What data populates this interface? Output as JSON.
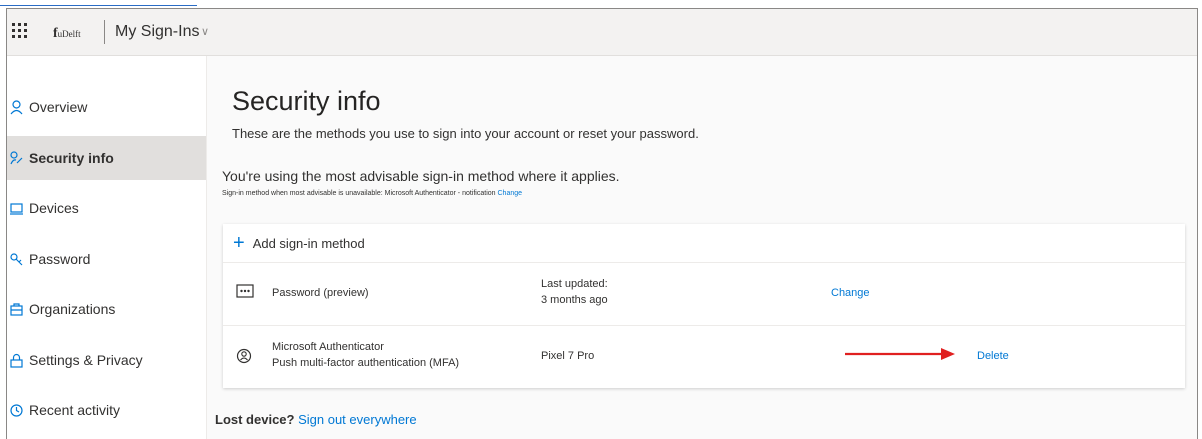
{
  "header": {
    "logo_mark": "f",
    "logo_text": "uDelft",
    "app_title": "My Sign-Ins"
  },
  "sidebar": {
    "items": [
      {
        "label": "Overview",
        "icon": "person-icon",
        "active": false
      },
      {
        "label": "Security info",
        "icon": "key-person-icon",
        "active": true
      },
      {
        "label": "Devices",
        "icon": "laptop-icon",
        "active": false
      },
      {
        "label": "Password",
        "icon": "key-icon",
        "active": false
      },
      {
        "label": "Organizations",
        "icon": "briefcase-icon",
        "active": false
      },
      {
        "label": "Settings & Privacy",
        "icon": "lock-icon",
        "active": false
      },
      {
        "label": "Recent activity",
        "icon": "clock-icon",
        "active": false
      }
    ]
  },
  "main": {
    "title": "Security info",
    "description": "These are the methods you use to sign into your account or reset your password.",
    "advisable": "You're using the most advisable sign-in method where it applies.",
    "sub_note": "Sign-in method when most advisable is unavailable: Microsoft Authenticator - notification",
    "sub_note_link": "Change",
    "add_method": "Add sign-in method",
    "methods": [
      {
        "name": "Password (preview)",
        "detail_label": "Last updated:",
        "detail_value": "3 months ago",
        "action": "Change",
        "icon": "password-dots-icon"
      },
      {
        "name": "Microsoft Authenticator",
        "sub": "Push multi-factor authentication (MFA)",
        "detail_value": "Pixel 7 Pro",
        "action": "Delete",
        "icon": "authenticator-icon"
      }
    ],
    "lost_device_label": "Lost device?",
    "sign_out_link": "Sign out everywhere"
  },
  "colors": {
    "accent": "#0078d4",
    "annotation_arrow": "#e02020",
    "active_nav": "#e1dfdd"
  }
}
